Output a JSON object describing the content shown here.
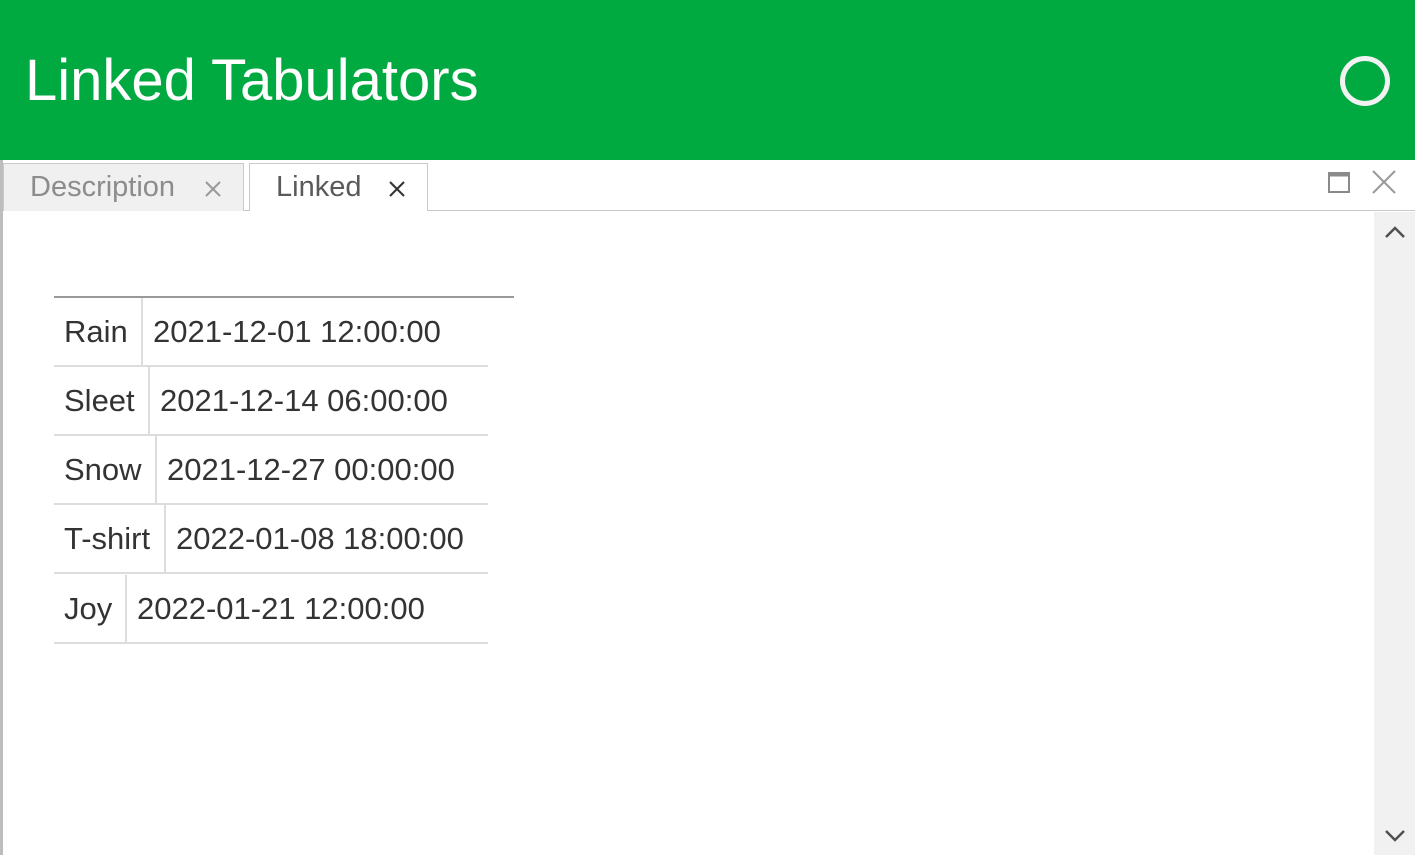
{
  "header": {
    "title": "Linked Tabulators",
    "accent_color": "#00aa41"
  },
  "tabs": [
    {
      "label": "Description",
      "active": false,
      "close_icon": "close-icon"
    },
    {
      "label": "Linked",
      "active": true,
      "close_icon": "close-icon"
    }
  ],
  "window_controls": {
    "maximize_icon": "maximize-icon",
    "close_icon": "close-icon"
  },
  "scrollbar": {
    "up_icon": "chevron-up-icon",
    "down_icon": "chevron-down-icon"
  },
  "table": {
    "rows": [
      {
        "name": "Rain",
        "date": "2021-12-01 12:00:00"
      },
      {
        "name": "Sleet",
        "date": "2021-12-14 06:00:00"
      },
      {
        "name": "Snow",
        "date": "2021-12-27 00:00:00"
      },
      {
        "name": "T-shirt",
        "date": "2022-01-08 18:00:00"
      },
      {
        "name": "Joy",
        "date": "2022-01-21 12:00:00"
      }
    ]
  }
}
